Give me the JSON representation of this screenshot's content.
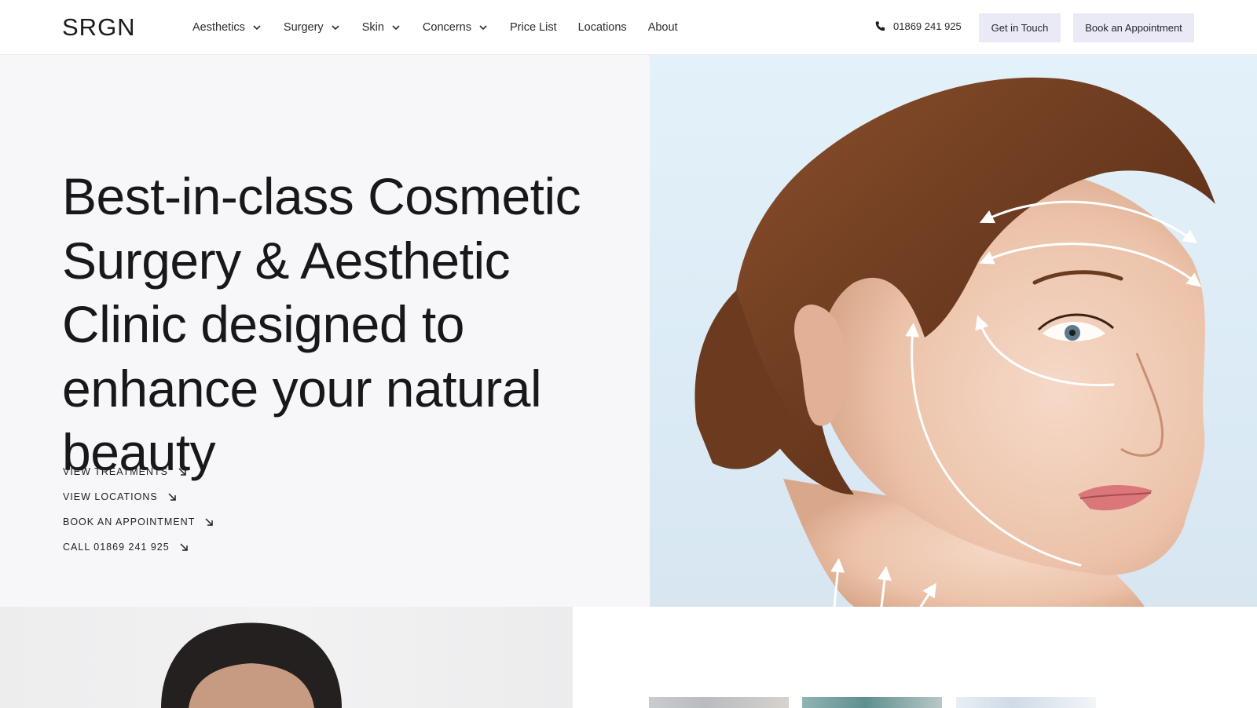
{
  "header": {
    "logo": "SRGN",
    "nav": [
      {
        "label": "Aesthetics",
        "has_dropdown": true
      },
      {
        "label": "Surgery",
        "has_dropdown": true
      },
      {
        "label": "Skin",
        "has_dropdown": true
      },
      {
        "label": "Concerns",
        "has_dropdown": true
      },
      {
        "label": "Price List",
        "has_dropdown": false
      },
      {
        "label": "Locations",
        "has_dropdown": false
      },
      {
        "label": "About",
        "has_dropdown": false
      }
    ],
    "phone": "01869 241 925",
    "phone_icon": "phone-icon",
    "buttons": {
      "get_in_touch": "Get in Touch",
      "book": "Book an Appointment"
    }
  },
  "hero": {
    "title": "Best-in-class Cosmetic Surgery & Aesthetic Clinic designed to enhance your natural beauty",
    "ctas": [
      {
        "label": "VIEW TREATMENTS",
        "icon": "arrow-down-right-icon"
      },
      {
        "label": "VIEW LOCATIONS",
        "icon": "arrow-down-right-icon"
      },
      {
        "label": "BOOK AN APPOINTMENT",
        "icon": "arrow-down-right-icon"
      },
      {
        "label": "CALL 01869 241 925",
        "icon": "arrow-down-right-icon"
      }
    ],
    "image": "woman-face-with-lift-arrows"
  },
  "lower": {
    "left_image": "man-portrait",
    "thumbnails": [
      "treatment-thumb-1",
      "treatment-thumb-2",
      "treatment-thumb-3"
    ]
  },
  "colors": {
    "button_bg": "#e9eaf5",
    "hero_left_bg": "#f7f7fa",
    "hero_right_bg": "#dcebf5",
    "text": "#18181c"
  }
}
